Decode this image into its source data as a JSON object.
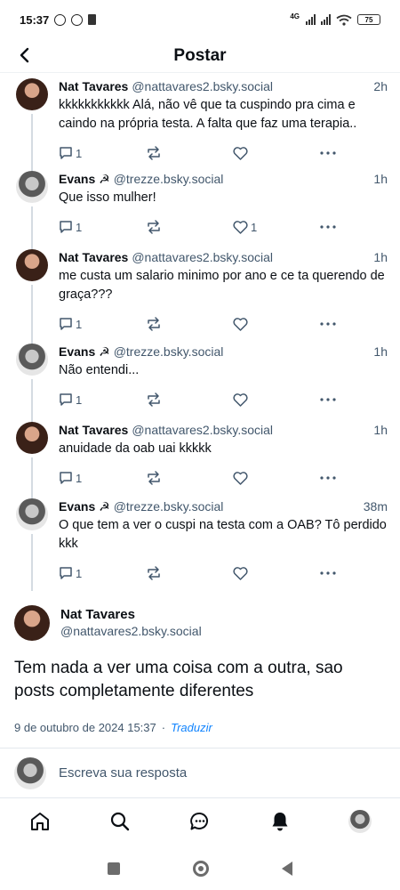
{
  "status_bar": {
    "time": "15:37",
    "network": "4G",
    "battery": "75"
  },
  "header": {
    "title": "Postar",
    "back_icon": "chevron-left-icon"
  },
  "replies": [
    {
      "author": "Nat Tavares",
      "handle": "@nattavares2.bsky.social",
      "time": "2h",
      "text": "kkkkkkkkkkk Alá, não vê que ta cuspindo pra cima e caindo na própria testa. A falta que faz uma terapia..",
      "reply_count": "1",
      "like_count": "",
      "avatar": "nat"
    },
    {
      "author": "Evans ☭",
      "handle": "@trezze.bsky.social",
      "time": "1h",
      "text": "Que isso mulher!",
      "reply_count": "1",
      "like_count": "1",
      "avatar": "evans"
    },
    {
      "author": "Nat Tavares",
      "handle": "@nattavares2.bsky.social",
      "time": "1h",
      "text": "me custa um salario minimo por ano e ce ta querendo de graça???",
      "reply_count": "1",
      "like_count": "",
      "avatar": "nat"
    },
    {
      "author": "Evans ☭",
      "handle": "@trezze.bsky.social",
      "time": "1h",
      "text": "Não entendi...",
      "reply_count": "1",
      "like_count": "",
      "avatar": "evans"
    },
    {
      "author": "Nat Tavares",
      "handle": "@nattavares2.bsky.social",
      "time": "1h",
      "text": "anuidade da oab uai kkkkk",
      "reply_count": "1",
      "like_count": "",
      "avatar": "nat"
    },
    {
      "author": "Evans ☭",
      "handle": "@trezze.bsky.social",
      "time": "38m",
      "text": "O que tem a ver o cuspi na testa com a OAB? Tô perdido kkk",
      "reply_count": "1",
      "like_count": "",
      "avatar": "evans"
    }
  ],
  "main_post": {
    "author": "Nat Tavares",
    "handle": "@nattavares2.bsky.social",
    "text": "Tem nada a ver uma coisa com a outra, sao posts completamente diferentes",
    "date": "9 de outubro de 2024 15:37",
    "separator": "·",
    "translate_label": "Traduzir"
  },
  "composer": {
    "placeholder": "Escreva sua resposta"
  },
  "bottom_nav": [
    "home-icon",
    "search-icon",
    "chat-icon",
    "bell-icon",
    "profile-avatar"
  ],
  "colors": {
    "accent": "#1083fe",
    "muted": "#42576c",
    "thread_line": "#d4dbe2"
  }
}
